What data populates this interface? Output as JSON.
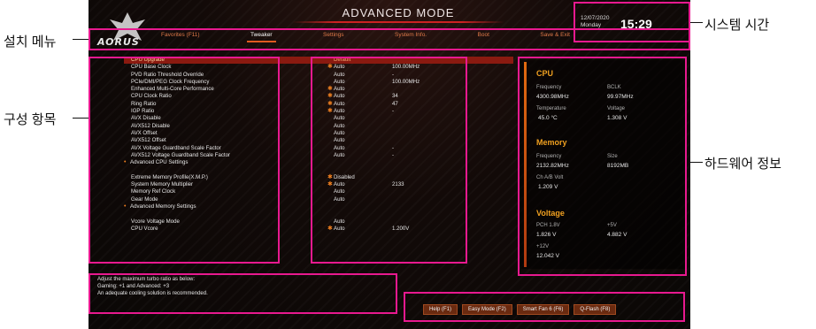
{
  "screen": {
    "mode_title": "ADVANCED MODE",
    "logo_text": "AORUS",
    "tabs": [
      "Favorites (F11)",
      "Tweaker",
      "Settings",
      "System Info.",
      "Boot",
      "Save & Exit"
    ],
    "active_tab": "Tweaker",
    "clock": {
      "date": "12/07/2020",
      "day": "Monday",
      "time": "15:29"
    },
    "settings": [
      {
        "name": "CPU Upgrade",
        "value": "Default",
        "value2": "",
        "star": false,
        "highlight": true,
        "sub": false
      },
      {
        "name": "CPU Base Clock",
        "value": "Auto",
        "value2": "100.00MHz",
        "star": true,
        "highlight": false,
        "sub": false
      },
      {
        "name": "PVD Ratio Threshold Override",
        "value": "Auto",
        "value2": "-",
        "star": false,
        "highlight": false,
        "sub": false
      },
      {
        "name": "PCIe/DMI/PEG Clock Frequency",
        "value": "Auto",
        "value2": "100.00MHz",
        "star": false,
        "highlight": false,
        "sub": false
      },
      {
        "name": "Enhanced Multi-Core Performance",
        "value": "Auto",
        "value2": "",
        "star": true,
        "highlight": false,
        "sub": false
      },
      {
        "name": "CPU Clock Ratio",
        "value": "Auto",
        "value2": "34",
        "star": true,
        "highlight": false,
        "sub": false
      },
      {
        "name": "Ring Ratio",
        "value": "Auto",
        "value2": "47",
        "star": true,
        "highlight": false,
        "sub": false
      },
      {
        "name": "IGP Ratio",
        "value": "Auto",
        "value2": "-",
        "star": true,
        "highlight": false,
        "sub": false
      },
      {
        "name": "AVX Disable",
        "value": "Auto",
        "value2": "",
        "star": false,
        "highlight": false,
        "sub": false
      },
      {
        "name": "AVX512 Disable",
        "value": "Auto",
        "value2": "",
        "star": false,
        "highlight": false,
        "sub": false
      },
      {
        "name": "AVX Offset",
        "value": "Auto",
        "value2": "",
        "star": false,
        "highlight": false,
        "sub": false
      },
      {
        "name": "AVX512 Offset",
        "value": "Auto",
        "value2": "",
        "star": false,
        "highlight": false,
        "sub": false
      },
      {
        "name": "AVX Voltage Guardband Scale Factor",
        "value": "Auto",
        "value2": "-",
        "star": false,
        "highlight": false,
        "sub": false
      },
      {
        "name": "AVX512 Voltage Guardband Scale Factor",
        "value": "Auto",
        "value2": "-",
        "star": false,
        "highlight": false,
        "sub": false
      },
      {
        "name": "Advanced CPU Settings",
        "value": "",
        "value2": "",
        "star": false,
        "highlight": false,
        "sub": true
      },
      {
        "name": "",
        "value": "",
        "value2": "",
        "star": false,
        "highlight": false,
        "sub": false
      },
      {
        "name": "Extreme Memory Profile(X.M.P.)",
        "value": "Disabled",
        "value2": "",
        "star": true,
        "highlight": false,
        "sub": false
      },
      {
        "name": "System Memory Multiplier",
        "value": "Auto",
        "value2": "2133",
        "star": true,
        "highlight": false,
        "sub": false
      },
      {
        "name": "Memory Ref Clock",
        "value": "Auto",
        "value2": "",
        "star": false,
        "highlight": false,
        "sub": false
      },
      {
        "name": "Gear Mode",
        "value": "Auto",
        "value2": "",
        "star": false,
        "highlight": false,
        "sub": false
      },
      {
        "name": "Advanced Memory Settings",
        "value": "",
        "value2": "",
        "star": false,
        "highlight": false,
        "sub": true
      },
      {
        "name": "",
        "value": "",
        "value2": "",
        "star": false,
        "highlight": false,
        "sub": false
      },
      {
        "name": "Vcore Voltage Mode",
        "value": "Auto",
        "value2": "",
        "star": false,
        "highlight": false,
        "sub": false
      },
      {
        "name": "CPU Vcore",
        "value": "Auto",
        "value2": "1.200V",
        "star": true,
        "highlight": false,
        "sub": false
      }
    ],
    "hw": {
      "cpu": {
        "title": "CPU",
        "freq_label": "Frequency",
        "freq": "4300.98MHz",
        "bclk_label": "BCLK",
        "bclk": "99.97MHz",
        "temp_label": "Temperature",
        "temp": "45.0 °C",
        "volt_label": "Voltage",
        "volt": "1.308 V"
      },
      "memory": {
        "title": "Memory",
        "freq_label": "Frequency",
        "freq": "2132.82MHz",
        "size_label": "Size",
        "size": "8192MB",
        "chab_label": "Ch A/B Volt",
        "chab": "1.209 V"
      },
      "voltage": {
        "title": "Voltage",
        "pch_label": "PCH 1.8V",
        "pch": "1.826 V",
        "p5_label": "+5V",
        "p5": "4.882 V",
        "p12_label": "+12V",
        "p12": "12.042 V"
      }
    },
    "description": [
      "Adjust the maximum turbo ratio as below:",
      "Gaming: +1 and Advanced: +3",
      "An adequate cooling solution is recommended."
    ],
    "function_buttons": [
      "Help (F1)",
      "Easy Mode (F2)",
      "Smart Fan 6 (F6)",
      "Q-Flash (F8)"
    ]
  },
  "callouts": {
    "menu": "설치 메뉴",
    "config": "구성 항목",
    "system_time": "시스템 시간",
    "hardware_info": "하드웨어 정보"
  },
  "colors": {
    "annotation_box": "#e8198f",
    "accent": "#e05a20",
    "highlight_row": "#8a1a10",
    "hw_heading": "#f0a020"
  }
}
